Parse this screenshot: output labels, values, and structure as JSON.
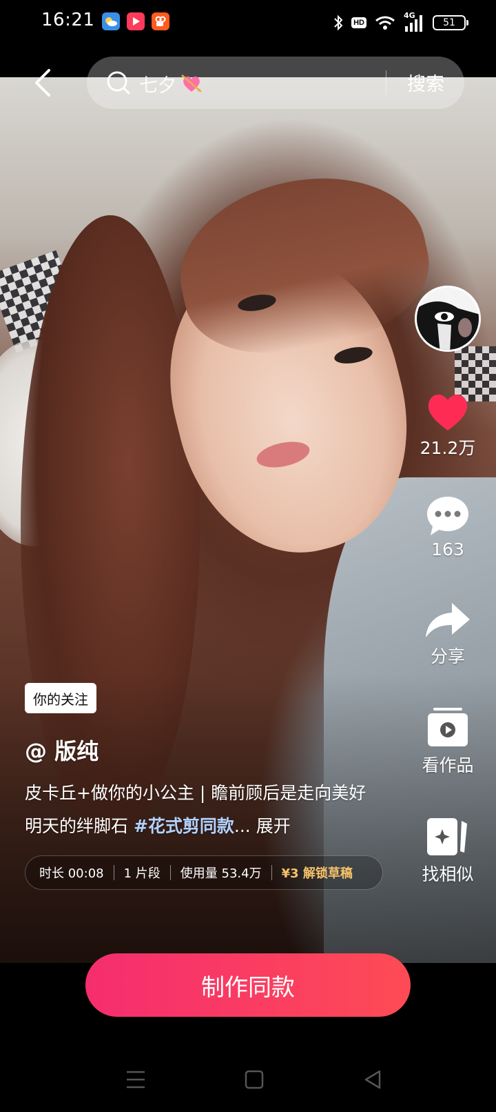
{
  "status_bar": {
    "time": "16:21",
    "hd_badge": "HD",
    "network": "4G",
    "battery": "51"
  },
  "search": {
    "query": "七夕",
    "emoji": "💘",
    "button": "搜索"
  },
  "rail": {
    "likes": "21.2万",
    "comments": "163",
    "share": "分享",
    "works": "看作品",
    "similar": "找相似"
  },
  "post": {
    "follow_tag": "你的关注",
    "username": "@ 版纯",
    "desc_text": "皮卡丘+做你的小公主 | 瞻前顾后是走向美好明天的绊脚石 ",
    "hashtag": "#花式剪同款",
    "ellipsis": "...",
    "expand": " 展开"
  },
  "info_strip": {
    "duration": "时长 00:08",
    "segments": "1 片段",
    "usage": "使用量 53.4万",
    "price": "¥3 解锁草稿"
  },
  "make_button": "制作同款",
  "colors": {
    "accent_start": "#f52d6f",
    "accent_end": "#fe4b55",
    "like_red": "#fe2c55",
    "hashtag_blue": "#b3d2ff",
    "price_gold": "#f5c26b"
  },
  "icons": [
    "back-icon",
    "search-icon",
    "heart-icon",
    "comment-icon",
    "share-icon",
    "works-icon",
    "similar-icon",
    "menu-icon",
    "home-icon",
    "back-nav-icon"
  ]
}
